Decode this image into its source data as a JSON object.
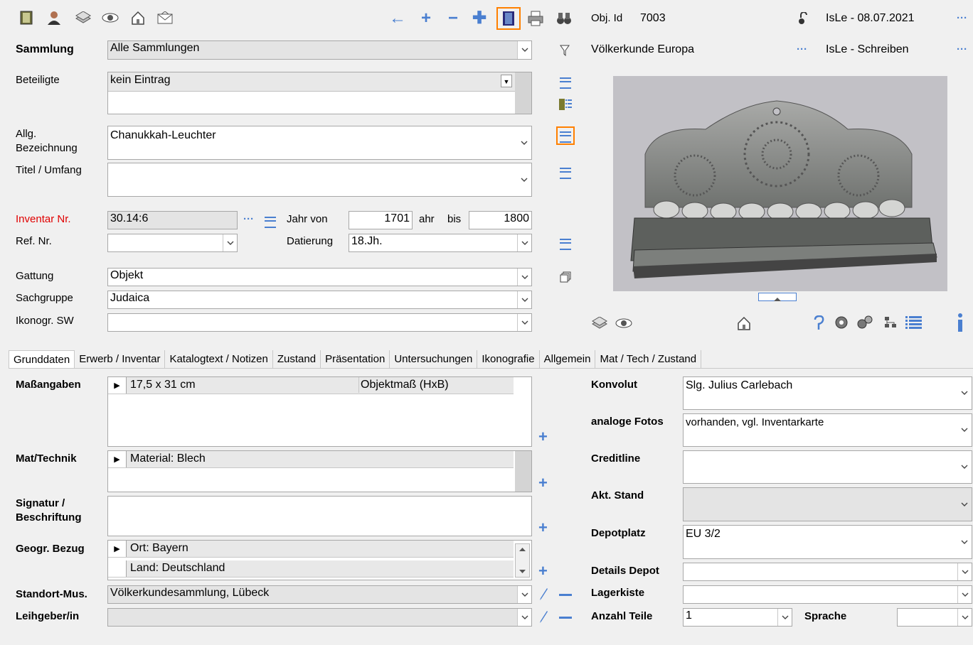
{
  "toolbar": {
    "nav": [
      "←",
      "+",
      "−",
      "✚"
    ]
  },
  "header": {
    "obj_id_label": "Obj. Id",
    "obj_id_value": "7003",
    "user_date": "IsLe - 08.07.2021",
    "collection_name": "Völkerkunde Europa",
    "user_write": "IsLe - Schreiben",
    "dots": "···"
  },
  "form": {
    "sammlung_label": "Sammlung",
    "sammlung_value": "Alle Sammlungen",
    "beteiligte_label": "Beteiligte",
    "beteiligte_value": "kein Eintrag",
    "allg_label_1": "Allg.",
    "allg_label_2": "Bezeichnung",
    "allg_value": "Chanukkah-Leuchter",
    "titel_label": "Titel / Umfang",
    "titel_value": "",
    "inventar_label": "Inventar Nr.",
    "inventar_value": "30.14:6",
    "jahr_von_label": "Jahr von",
    "jahr_von_value": "1701",
    "ahr_label": "ahr",
    "bis_label": "bis",
    "bis_value": "1800",
    "ref_label": "Ref. Nr.",
    "ref_value": "",
    "datierung_label": "Datierung",
    "datierung_value": "18.Jh.",
    "gattung_label": "Gattung",
    "gattung_value": "Objekt",
    "sachgruppe_label": "Sachgruppe",
    "sachgruppe_value": "Judaica",
    "ikonogr_label": "Ikonogr. SW",
    "ikonogr_value": ""
  },
  "tabs": [
    "Grunddaten",
    "Erwerb / Inventar",
    "Katalogtext / Notizen",
    "Zustand",
    "Präsentation",
    "Untersuchungen",
    "Ikonografie",
    "Allgemein",
    "Mat / Tech / Zustand"
  ],
  "grund": {
    "masse_label": "Maßangaben",
    "masse_value": "17,5 x 31 cm",
    "masse_type": "Objektmaß (HxB)",
    "mat_label": "Mat/Technik",
    "mat_value": "Material: Blech",
    "sig_label_1": "Signatur /",
    "sig_label_2": "Beschriftung",
    "geo_label": "Geogr. Bezug",
    "geo_rows": [
      "Ort: Bayern",
      "Land: Deutschland"
    ],
    "standort_label": "Standort-Mus.",
    "standort_value": "Völkerkundesammlung, Lübeck",
    "leih_label": "Leihgeber/in",
    "leih_value": "",
    "konvolut_label": "Konvolut",
    "konvolut_value": "Slg. Julius Carlebach",
    "fotos_label": "analoge Fotos",
    "fotos_value": "vorhanden, vgl. Inventarkarte",
    "credit_label": "Creditline",
    "credit_value": "",
    "akt_label": "Akt. Stand",
    "akt_value": "",
    "depot_label": "Depotplatz",
    "depot_value": "EU 3/2",
    "details_label": "Details Depot",
    "details_value": "",
    "kiste_label": "Lagerkiste",
    "kiste_value": "",
    "teile_label": "Anzahl Teile",
    "teile_value": "1",
    "sprache_label": "Sprache",
    "sprache_value": ""
  },
  "colors": {
    "accent": "#4a7fd0",
    "required": "#e00000",
    "highlight": "#ff8000"
  }
}
